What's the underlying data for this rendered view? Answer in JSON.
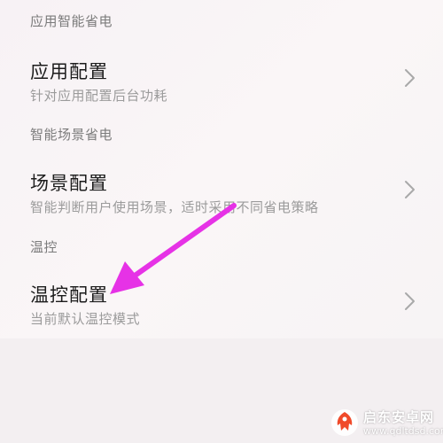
{
  "sections": [
    {
      "header": "应用智能省电",
      "item": {
        "title": "应用配置",
        "subtitle": "针对应用配置后台功耗"
      }
    },
    {
      "header": "智能场景省电",
      "item": {
        "title": "场景配置",
        "subtitle": "智能判断用户使用场景，适时采用不同省电策略"
      }
    },
    {
      "header": "温控",
      "item": {
        "title": "温控配置",
        "subtitle": "当前默认温控模式"
      }
    }
  ],
  "icons": {
    "chevron": "chevron-right-icon"
  },
  "annotation": {
    "arrow_color": "#e632e6"
  },
  "watermark": {
    "title": "启东安卓网",
    "url": "www.qdltdsd.com",
    "logo_color": "#f04a2a"
  }
}
